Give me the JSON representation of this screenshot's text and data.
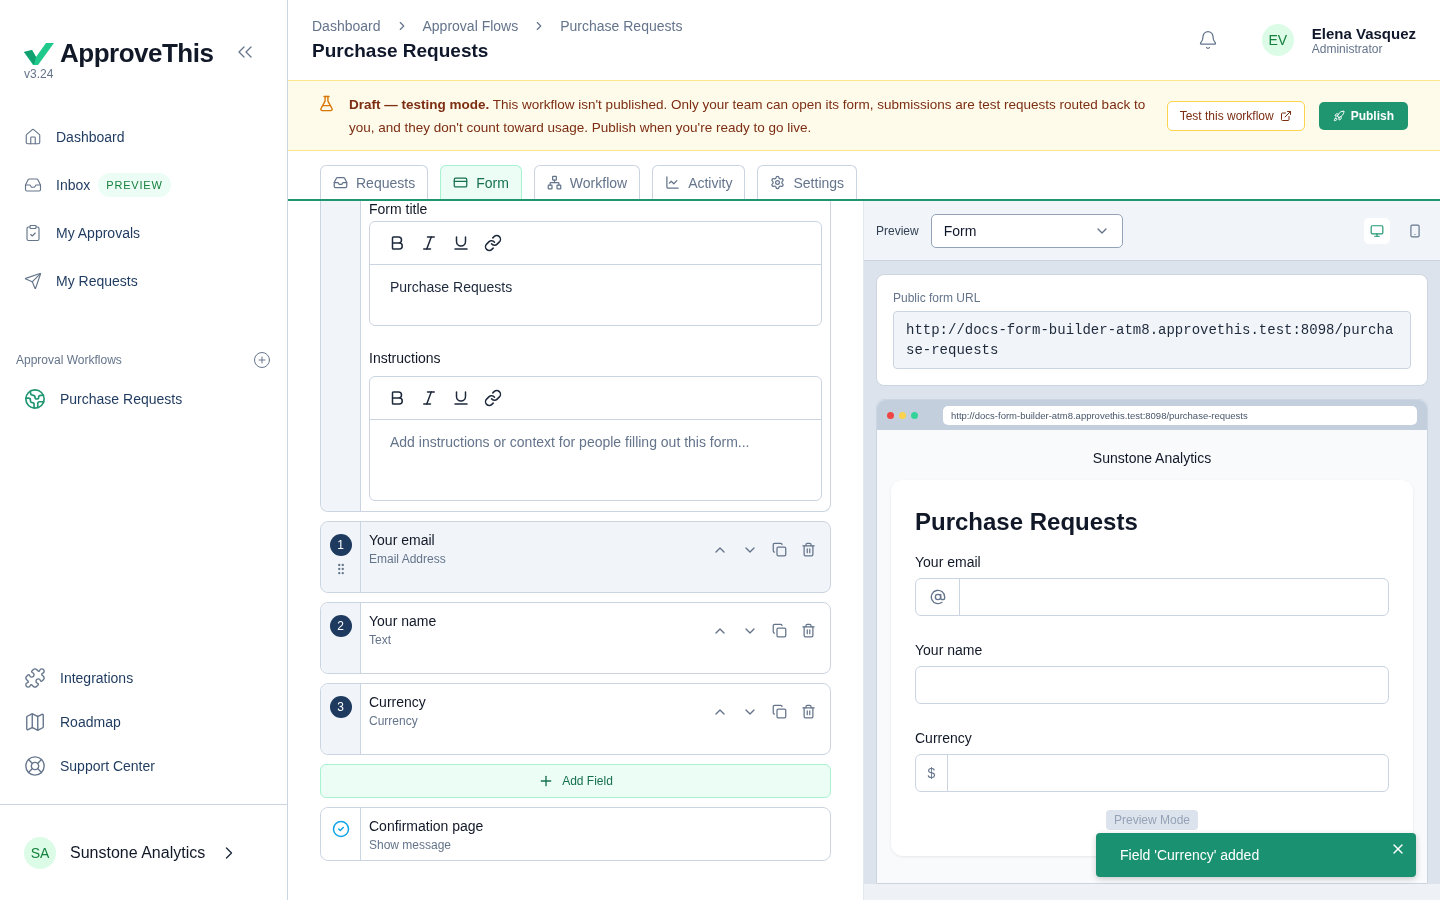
{
  "sidebar": {
    "brand": "ApproveThis",
    "version": "v3.24",
    "nav": [
      {
        "label": "Dashboard"
      },
      {
        "label": "Inbox",
        "badge": "PREVIEW"
      },
      {
        "label": "My Approvals"
      },
      {
        "label": "My Requests"
      }
    ],
    "section_title": "Approval Workflows",
    "workflows": [
      {
        "label": "Purchase Requests"
      }
    ],
    "footer_links": [
      {
        "label": "Integrations"
      },
      {
        "label": "Roadmap"
      },
      {
        "label": "Support Center"
      }
    ],
    "org": {
      "initials": "SA",
      "name": "Sunstone Analytics"
    }
  },
  "header": {
    "breadcrumbs": [
      "Dashboard",
      "Approval Flows",
      "Purchase Requests"
    ],
    "title": "Purchase Requests",
    "user": {
      "initials": "EV",
      "name": "Elena Vasquez",
      "role": "Administrator"
    }
  },
  "banner": {
    "text": "**Draft — testing mode.** This workflow isn't published. Only your team can open its form, submissions are test requests routed back to you, and they don't count toward usage. Publish when you're ready to go live.",
    "test_button": "Test this workflow",
    "publish_button": "Publish"
  },
  "tabs": [
    {
      "label": "Requests",
      "selected": false
    },
    {
      "label": "Form",
      "selected": true
    },
    {
      "label": "Workflow",
      "selected": false
    },
    {
      "label": "Activity",
      "selected": false
    },
    {
      "label": "Settings",
      "selected": false
    }
  ],
  "editor": {
    "form_title": {
      "label": "Form title",
      "value": "Purchase Requests"
    },
    "instructions": {
      "label": "Instructions",
      "placeholder": "Add instructions or context for people filling out this form..."
    },
    "fields": [
      {
        "number": "1",
        "label": "Your email",
        "type": "Email Address",
        "selected": true
      },
      {
        "number": "2",
        "label": "Your name",
        "type": "Text",
        "selected": false
      },
      {
        "number": "3",
        "label": "Currency",
        "type": "Currency",
        "selected": false
      }
    ],
    "add_field": "Add Field",
    "confirmation": {
      "title": "Confirmation page",
      "subtitle": "Show message"
    }
  },
  "preview": {
    "label": "Preview",
    "select": "Form",
    "devices": [
      {
        "kind": "desktop",
        "selected": true
      },
      {
        "kind": "mobile",
        "selected": false
      }
    ],
    "public_url": {
      "label": "Public form URL",
      "value": "http://docs-form-builder-atm8.approvethis.test:8098/purchase-requests"
    },
    "browser": {
      "url": "http://docs-form-builder-atm8.approvethis.test:8098/purchase-requests",
      "org": "Sunstone Analytics",
      "form_title": "Purchase Requests",
      "fields": [
        {
          "label": "Your email",
          "kind": "email"
        },
        {
          "label": "Your name",
          "kind": "text"
        },
        {
          "label": "Currency",
          "kind": "currency",
          "prefix": "$"
        }
      ],
      "badge": "Preview Mode"
    },
    "toast": "Field 'Currency' added"
  }
}
